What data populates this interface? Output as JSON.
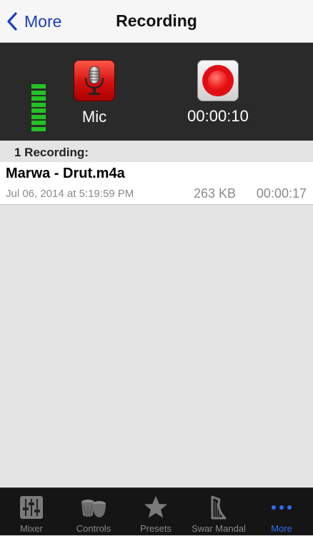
{
  "nav": {
    "back_label": "More",
    "title": "Recording"
  },
  "controls": {
    "input_label": "Mic",
    "timer": "00:00:10",
    "meter_level_bars": 8
  },
  "list": {
    "section_header": "1 Recording:",
    "items": [
      {
        "name": "Marwa - Drut.m4a",
        "date": "Jul 06, 2014 at 5:19:59 PM",
        "size": "263 KB",
        "duration": "00:00:17"
      }
    ]
  },
  "tabs": [
    {
      "label": "Mixer",
      "icon": "mixer-sliders-icon",
      "active": false
    },
    {
      "label": "Controls",
      "icon": "tabla-drums-icon",
      "active": false
    },
    {
      "label": "Presets",
      "icon": "star-icon",
      "active": false
    },
    {
      "label": "Swar Mandal",
      "icon": "harp-icon",
      "active": false
    },
    {
      "label": "More",
      "icon": "more-dots-icon",
      "active": true
    }
  ],
  "colors": {
    "accent": "#2f6df5",
    "record_red": "#e10f14",
    "meter_green": "#22c322",
    "panel_bg": "#2a2a2a"
  }
}
